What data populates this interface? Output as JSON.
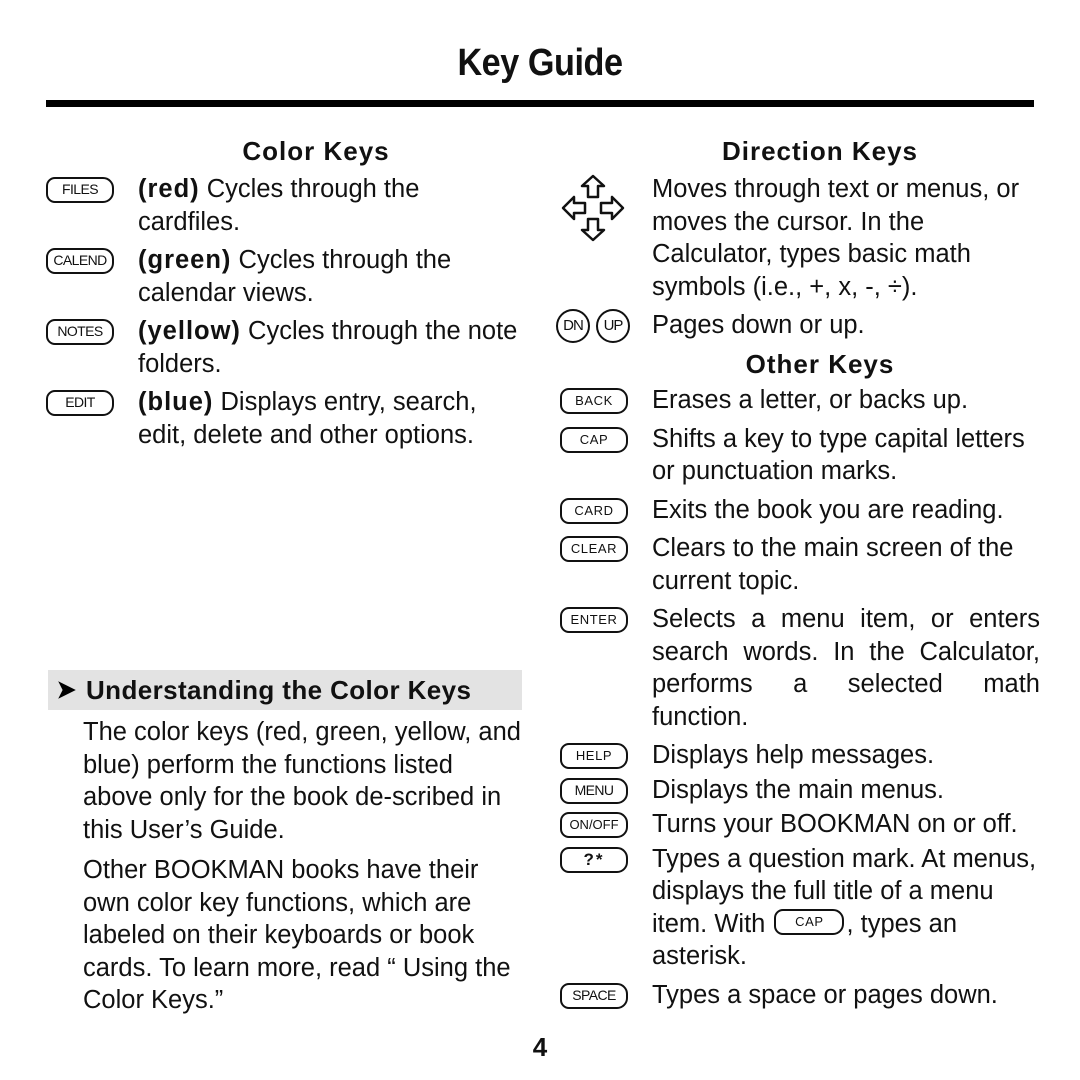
{
  "page": {
    "title": "Key Guide",
    "page_number": "4"
  },
  "color_keys": {
    "heading": "Color Keys",
    "items": [
      {
        "key": "FILES",
        "color_word": "(red)",
        "text": " Cycles through the cardfiles."
      },
      {
        "key": "CALEND",
        "color_word": "(green)",
        "text": " Cycles through the calendar views."
      },
      {
        "key": "NOTES",
        "color_word": "(yellow)",
        "text": " Cycles through the note folders."
      },
      {
        "key": "EDIT",
        "color_word": "(blue)",
        "text": " Displays entry, search, edit, delete and other options."
      }
    ]
  },
  "understanding": {
    "heading": "Understanding the Color Keys",
    "arrow_icon": "right-arrowhead-icon",
    "paragraphs": [
      "The color keys (red, green, yellow, and blue) perform the functions listed above only for the book de-scribed in this User’s Guide.",
      "Other BOOKMAN books have their own color key functions, which are labeled on their keyboards or book cards. To learn more, read “ Using the Color Keys.”"
    ]
  },
  "direction_keys": {
    "heading": "Direction Keys",
    "arrows": {
      "icon": "direction-arrows-icon",
      "text": "Moves through text or menus, or moves the cursor. In the Calculator, types basic math symbols (i.e., +, x, -, ÷)."
    },
    "pages": {
      "key_dn": "DN",
      "key_up": "UP",
      "text": "Pages down or up."
    }
  },
  "other_keys": {
    "heading": "Other Keys",
    "items": [
      {
        "key": "BACK",
        "text": "Erases a letter, or backs up."
      },
      {
        "key": "CAP",
        "text": "Shifts a key to type capital letters or punctuation marks."
      },
      {
        "key": "CARD",
        "text": "Exits the book you are reading."
      },
      {
        "key": "CLEAR",
        "text": "Clears to the main screen of the current topic."
      },
      {
        "key": "ENTER",
        "text": "Selects a menu item, or enters search words. In the Calculator, performs a selected math function."
      },
      {
        "key": "HELP",
        "text": "Displays help messages."
      },
      {
        "key": "MENU",
        "text": "Displays the main menus."
      },
      {
        "key": "ON/OFF",
        "text": "Turns your BOOKMAN on or off."
      },
      {
        "key": "?*",
        "text_before": "Types a question mark. At menus, displays the full title of a menu item. With ",
        "inline_key": "CAP",
        "text_after": ", types an asterisk."
      },
      {
        "key": "SPACE",
        "text": "Types a space or pages down."
      }
    ]
  }
}
